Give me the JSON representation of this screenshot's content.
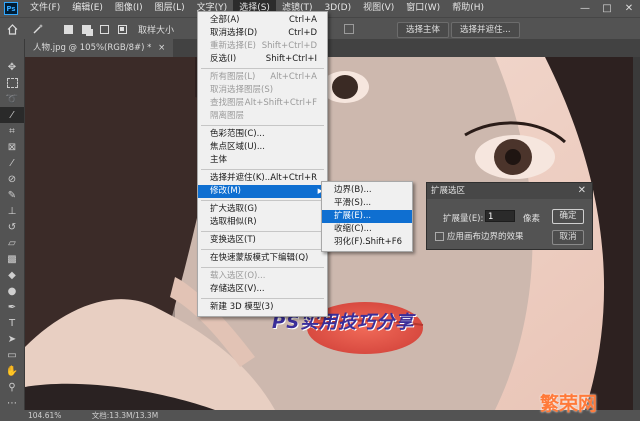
{
  "app": {
    "logo": "Ps"
  },
  "menubar": {
    "items": [
      "文件(F)",
      "编辑(E)",
      "图像(I)",
      "图层(L)",
      "文字(Y)",
      "选择(S)",
      "滤镜(T)",
      "3D(D)",
      "视图(V)",
      "窗口(W)",
      "帮助(H)"
    ],
    "window_controls": [
      "—",
      "□",
      "✕"
    ]
  },
  "options_bar": {
    "sample_size_label": "取样大小",
    "select_subject": "选择主体",
    "select_and_mask": "选择并遮住..."
  },
  "document": {
    "tab_title": "人物.jpg @ 105%(RGB/8#) *",
    "tab_close": "×"
  },
  "select_menu": {
    "items": [
      {
        "label": "全部(A)",
        "shortcut": "Ctrl+A",
        "disabled": false
      },
      {
        "label": "取消选择(D)",
        "shortcut": "Ctrl+D",
        "disabled": false
      },
      {
        "label": "重新选择(E)",
        "shortcut": "Shift+Ctrl+D",
        "disabled": true
      },
      {
        "label": "反选(I)",
        "shortcut": "Shift+Ctrl+I",
        "disabled": false
      },
      {
        "sep": true
      },
      {
        "label": "所有图层(L)",
        "shortcut": "Alt+Ctrl+A",
        "disabled": true
      },
      {
        "label": "取消选择图层(S)",
        "shortcut": "",
        "disabled": true
      },
      {
        "label": "查找图层",
        "shortcut": "Alt+Shift+Ctrl+F",
        "disabled": true
      },
      {
        "label": "隔离图层",
        "shortcut": "",
        "disabled": true
      },
      {
        "sep": true
      },
      {
        "label": "色彩范围(C)...",
        "shortcut": "",
        "disabled": false
      },
      {
        "label": "焦点区域(U)...",
        "shortcut": "",
        "disabled": false
      },
      {
        "label": "主体",
        "shortcut": "",
        "disabled": false
      },
      {
        "sep": true
      },
      {
        "label": "选择并遮住(K)...",
        "shortcut": "Alt+Ctrl+R",
        "disabled": false
      },
      {
        "label": "修改(M)",
        "shortcut": "",
        "disabled": false,
        "highlight": true,
        "submenu": true
      },
      {
        "sep": true
      },
      {
        "label": "扩大选取(G)",
        "shortcut": "",
        "disabled": false
      },
      {
        "label": "选取相似(R)",
        "shortcut": "",
        "disabled": false
      },
      {
        "sep": true
      },
      {
        "label": "变换选区(T)",
        "shortcut": "",
        "disabled": false
      },
      {
        "sep": true
      },
      {
        "label": "在快速蒙版模式下编辑(Q)",
        "shortcut": "",
        "disabled": false
      },
      {
        "sep": true
      },
      {
        "label": "载入选区(O)...",
        "shortcut": "",
        "disabled": true
      },
      {
        "label": "存储选区(V)...",
        "shortcut": "",
        "disabled": false
      },
      {
        "sep": true
      },
      {
        "label": "新建 3D 模型(3)",
        "shortcut": "",
        "disabled": false
      }
    ]
  },
  "modify_submenu": {
    "items": [
      {
        "label": "边界(B)...",
        "shortcut": "",
        "highlight": false
      },
      {
        "label": "平滑(S)...",
        "shortcut": "",
        "highlight": false
      },
      {
        "label": "扩展(E)...",
        "shortcut": "",
        "highlight": true
      },
      {
        "label": "收缩(C)...",
        "shortcut": "",
        "highlight": false
      },
      {
        "label": "羽化(F)...",
        "shortcut": "Shift+F6",
        "highlight": false
      }
    ]
  },
  "expand_dialog": {
    "title": "扩展选区",
    "close": "✕",
    "amount_label": "扩展量(E):",
    "amount_value": "1",
    "unit": "像素",
    "checkbox_label": "应用画布边界的效果",
    "ok": "确定",
    "cancel": "取消"
  },
  "canvas": {
    "overlay_text": "PS实用技巧分享",
    "corner_watermark": "繁荣网"
  },
  "status": {
    "zoom": "104.61%",
    "doc_info": "文档:13.3M/13.3M"
  }
}
